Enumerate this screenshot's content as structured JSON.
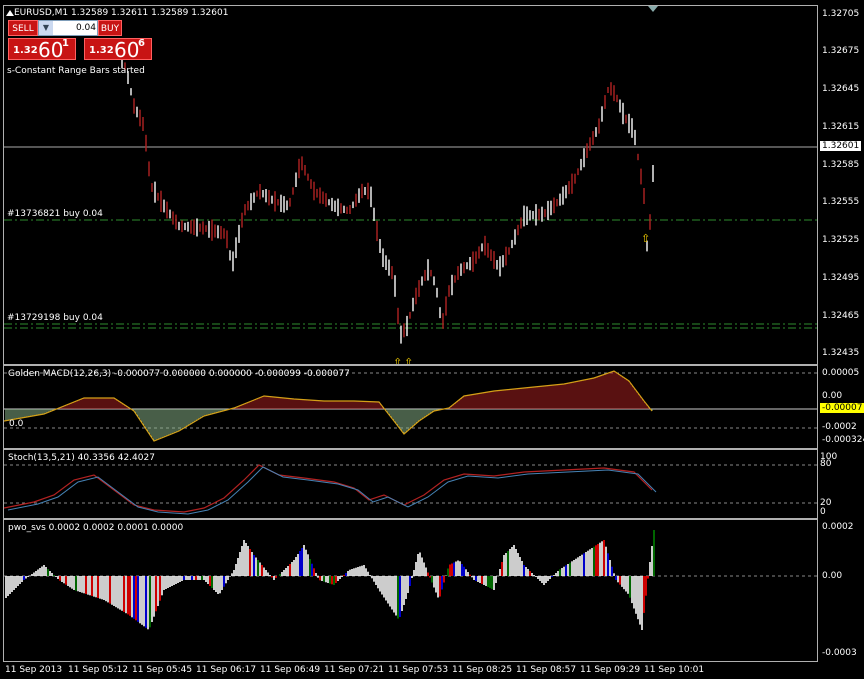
{
  "window": {
    "symbol_title": "EURUSD,M1  1.32589  1.32611  1.32589  1.32601",
    "status_text": "s-Constant Range Bars started"
  },
  "trade_panel": {
    "sell_label": "SELL",
    "buy_label": "BUY",
    "lot_value": "0.04",
    "sell_price_small": "1.32",
    "sell_price_big": "60",
    "sell_price_sup": "1",
    "buy_price_small": "1.32",
    "buy_price_big": "60",
    "buy_price_sup": "6"
  },
  "orders": [
    {
      "label": "#13736821 buy 0.04"
    },
    {
      "label": "#13729198 buy 0.04"
    }
  ],
  "price_axis": {
    "labels": [
      "1.32705",
      "1.32675",
      "1.32645",
      "1.32615",
      "1.32585",
      "1.32555",
      "1.32525",
      "1.32495",
      "1.32465",
      "1.32435"
    ],
    "current_price_tag": "1.32601"
  },
  "macd": {
    "title": "Golden MACD(12,26,3) -0.000077 0.000000 0.000000 -0.000099 -0.000077",
    "axis_labels": [
      "0.00005",
      "0.00",
      "-0.0002",
      "-0.000324"
    ],
    "current_tag": "-0.00007",
    "left_label": "0.0"
  },
  "stoch": {
    "title": "Stoch(13,5,21) 40.3356 42.4027",
    "axis_labels": [
      "100",
      "80",
      "20",
      "0"
    ]
  },
  "pwo": {
    "title": "pwo_svs 0.0002 0.0002 0.0001 0.0000",
    "axis_labels": [
      "0.0002",
      "0.00",
      "-0.0003"
    ]
  },
  "time_axis": {
    "labels": [
      "11 Sep 2013",
      "11 Sep 05:12",
      "11 Sep 05:45",
      "11 Sep 06:17",
      "11 Sep 06:49",
      "11 Sep 07:21",
      "11 Sep 07:53",
      "11 Sep 08:25",
      "11 Sep 08:57",
      "11 Sep 09:29",
      "11 Sep 10:01"
    ]
  },
  "colors": {
    "background": "#000000",
    "bull_bar": "#ffffff",
    "bear_bar": "#b22222",
    "order_line": "#2e8b2e",
    "macd_hist": "#8fbc8f",
    "stoch_main": "#b22222",
    "stoch_signal": "#4682b4",
    "pwo_white": "#ffffff",
    "pwo_red": "#ff0000",
    "pwo_green": "#008000",
    "pwo_blue": "#0000ff",
    "arrow": "#ffd700"
  }
}
